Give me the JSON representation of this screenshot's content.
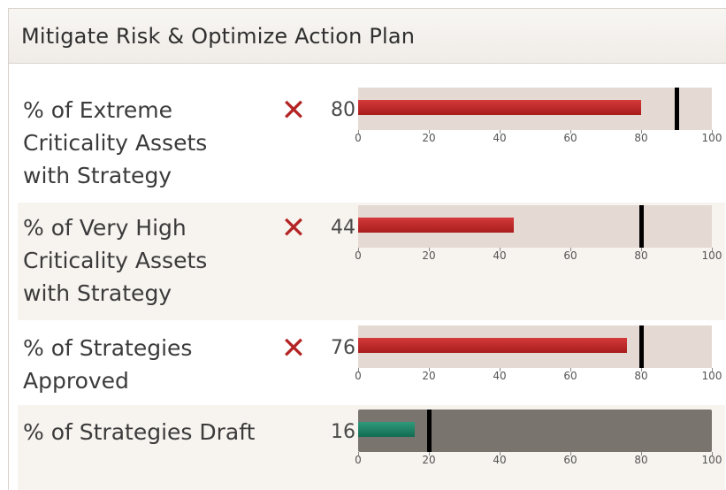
{
  "header": {
    "title": "Mitigate Risk & Optimize Action Plan"
  },
  "axis_ticks": [
    "0",
    "20",
    "40",
    "60",
    "80",
    "100"
  ],
  "colors": {
    "status_fail": "#b32525",
    "bar_red": "#c22a2a",
    "bar_green": "#1d7d61",
    "track": "#e4dad3",
    "track_dark": "#7a746f",
    "target": "#000000"
  },
  "metrics": [
    {
      "label_lines": [
        "% of Extreme",
        "Criticality Assets",
        "with Strategy"
      ],
      "status_icon": "x-mark-icon",
      "status_glyph": "✕",
      "value": "80",
      "actual": 80,
      "target": 90,
      "bar_color": "red",
      "track_style": "light"
    },
    {
      "label_lines": [
        "% of Very High",
        "Criticality Assets",
        "with Strategy"
      ],
      "status_icon": "x-mark-icon",
      "status_glyph": "✕",
      "value": "44",
      "actual": 44,
      "target": 80,
      "bar_color": "red",
      "track_style": "light"
    },
    {
      "label_lines": [
        "% of Strategies",
        "Approved"
      ],
      "status_icon": "x-mark-icon",
      "status_glyph": "✕",
      "value": "76",
      "actual": 76,
      "target": 80,
      "bar_color": "red",
      "track_style": "light"
    },
    {
      "label_lines": [
        "% of Strategies Draft"
      ],
      "status_icon": "",
      "status_glyph": "",
      "value": "16",
      "actual": 16,
      "target": 20,
      "bar_color": "green",
      "track_style": "dark"
    }
  ]
}
